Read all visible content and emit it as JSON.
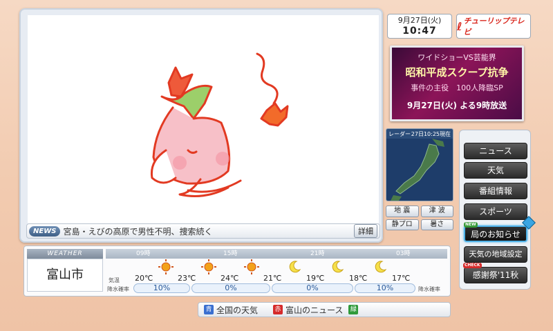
{
  "clock": {
    "date": "9月27日(火)",
    "time": "10:47"
  },
  "logo": {
    "text": "チューリップテレビ"
  },
  "promo": {
    "line1": "ワイドショーVS芸能界",
    "line2": "昭和平成スクープ抗争",
    "line3": "事件の主役　100人降臨SP",
    "line4": "9月27日(火) よる9時放送"
  },
  "news": {
    "tag": "NEWS",
    "text": "宮島・えびの高原で男性不明、捜索続く",
    "detail_label": "詳細"
  },
  "radar": {
    "title": "レーダー",
    "timestamp": "27日10:25現在"
  },
  "mini_buttons": [
    "地 震",
    "津 波",
    "静プロ",
    "暑さ"
  ],
  "menu": [
    {
      "label": "ニュース"
    },
    {
      "label": "天気"
    },
    {
      "label": "番組情報"
    },
    {
      "label": "スポーツ"
    },
    {
      "label": "局のお知らせ",
      "badge": "NEW"
    },
    {
      "label": "天気の地域設定"
    },
    {
      "label": "感謝祭'11秋",
      "badge": "CHECK"
    }
  ],
  "weather": {
    "header": "WEATHER",
    "city": "富山市",
    "times": [
      "09時",
      "15時",
      "21時",
      "03時"
    ],
    "temp_label": "気温",
    "pop_label": "降水確率",
    "icons": [
      "sun-icon",
      "sun-icon",
      "sun-icon",
      "moon-icon",
      "moon-icon",
      "moon-icon"
    ],
    "temps": [
      "20℃",
      "23℃",
      "24℃",
      "21℃",
      "19℃",
      "18℃",
      "17℃"
    ],
    "pops": [
      "10%",
      "0%",
      "0%",
      "10%"
    ]
  },
  "bottom": {
    "item1": "全国の天気",
    "item2": "富山のニュース"
  },
  "colors": {
    "key_blue": "#3a6fd0",
    "key_red": "#d52a2a",
    "key_green": "#2f9a3a",
    "selected_border": "#4fb2e8"
  }
}
